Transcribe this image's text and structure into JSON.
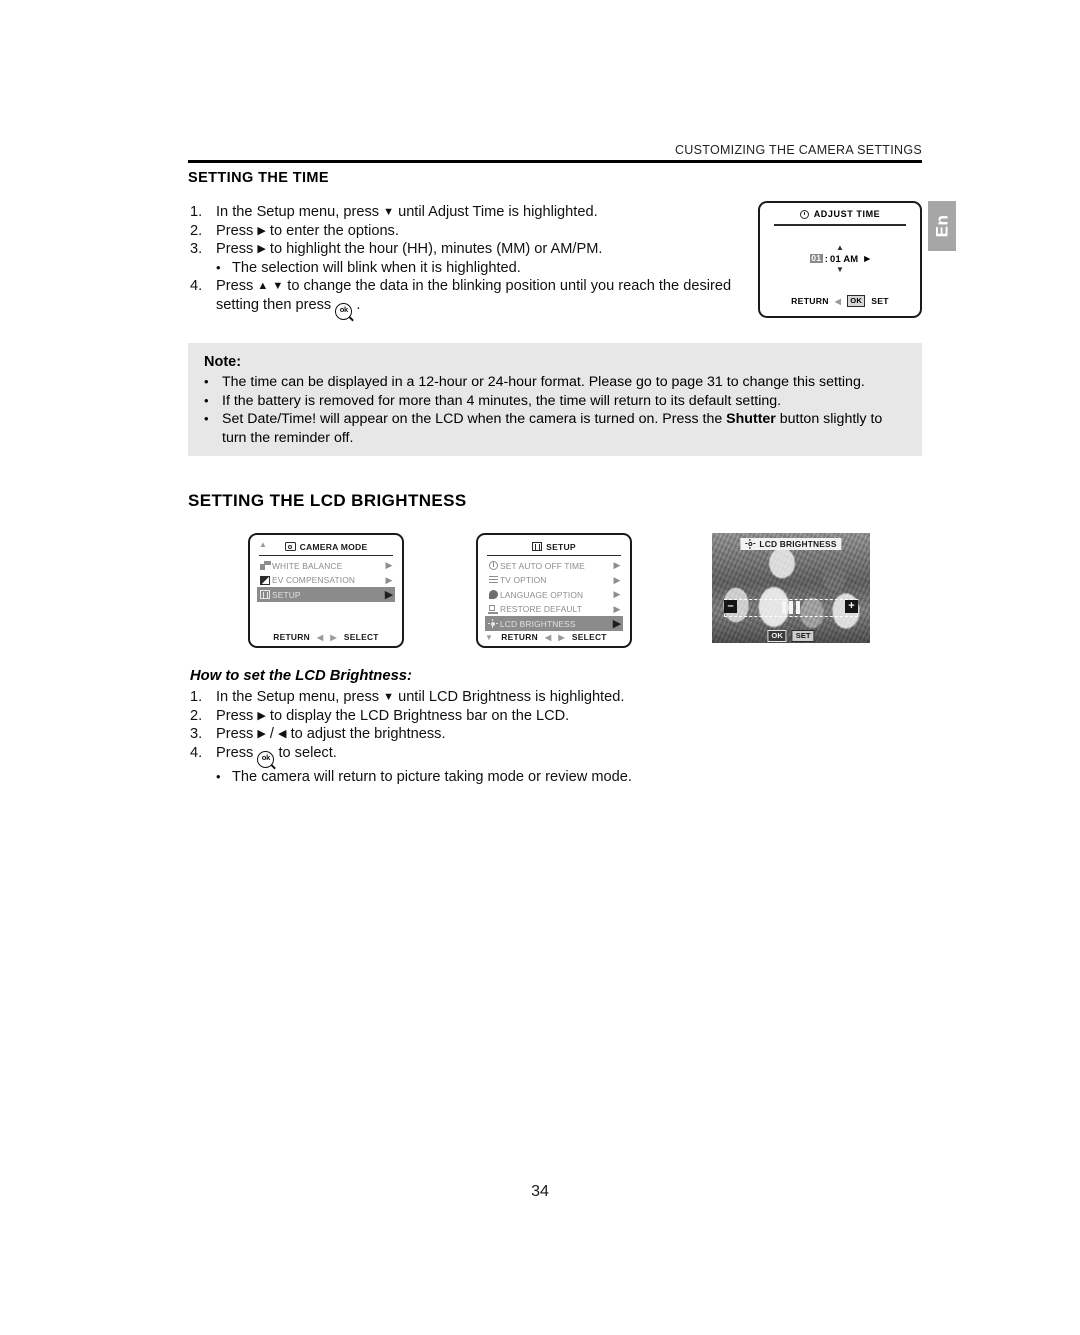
{
  "header": {
    "running_head": "CUSTOMIZING THE CAMERA SETTINGS",
    "language_tab": "En"
  },
  "sections": {
    "time": {
      "heading": "SETTING THE TIME",
      "steps": [
        {
          "num": "1.",
          "text_before": "In the Setup menu, press",
          "icon": "down-arrow-icon",
          "text_after": "until Adjust Time is highlighted."
        },
        {
          "num": "2.",
          "text_before": "Press",
          "icon": "right-arrow-icon",
          "text_after": "to enter the options."
        },
        {
          "num": "3.",
          "text_before": "Press",
          "icon": "right-arrow-icon",
          "text_after": "to highlight the hour (HH), minutes (MM) or AM/PM."
        }
      ],
      "sub_bullet": "The selection will blink when it is highlighted.",
      "step4": {
        "num": "4.",
        "text_before": "Press",
        "icons": "up-arrow-icon down-arrow-icon",
        "text_after": "to change the data in the blinking position until you reach the desired setting then press",
        "trailing": "."
      }
    },
    "lcd": {
      "heading": "SETTING THE LCD BRIGHTNESS",
      "how_title": "How to set the LCD Brightness:",
      "steps": [
        {
          "num": "1.",
          "text_before": "In the Setup menu, press",
          "icon": "down-arrow-icon",
          "text_after": "until LCD Brightness is highlighted."
        },
        {
          "num": "2.",
          "text_before": "Press",
          "icon": "right-arrow-icon",
          "text_after": "to display the LCD Brightness bar on the LCD."
        },
        {
          "num": "3.",
          "text_before": "Press",
          "icon": "right-arrow-icon",
          "mid": "/",
          "icon2": "left-arrow-icon",
          "text_after": "to adjust the brightness."
        },
        {
          "num": "4.",
          "text_before": "Press",
          "icon": "ok-button-icon",
          "text_after": "to select."
        }
      ],
      "sub_bullet": "The camera will return to picture taking mode or review mode."
    }
  },
  "note": {
    "title": "Note:",
    "items": [
      "The time can be displayed in a 12-hour or 24-hour format. Please go to page 31 to change this setting.",
      "If the battery is removed for more than 4 minutes, the time will return to its default setting.",
      "Set Date/Time! will appear on the LCD when the camera is turned on. Press the Shutter button slightly to turn the reminder off."
    ],
    "bold_word": "Shutter"
  },
  "screens": {
    "adjust_time": {
      "title": "ADJUST TIME",
      "hour": "01",
      "separator": ":",
      "minutes_ampm": "01 AM",
      "footer_return": "RETURN",
      "footer_ok": "OK",
      "footer_set": "SET"
    },
    "camera_mode": {
      "title": "CAMERA MODE",
      "items": [
        {
          "label": "WHITE BALANCE",
          "icon": "white-balance-icon",
          "selected": false
        },
        {
          "label": "EV COMPENSATION",
          "icon": "ev-compensation-icon",
          "selected": false
        },
        {
          "label": "SETUP",
          "icon": "setup-icon",
          "selected": true
        }
      ],
      "footer_return": "RETURN",
      "footer_select": "SELECT"
    },
    "setup": {
      "title": "SETUP",
      "items": [
        {
          "label": "SET AUTO OFF TIME",
          "icon": "power-icon",
          "selected": false
        },
        {
          "label": "TV OPTION",
          "icon": "tv-icon",
          "selected": false
        },
        {
          "label": "LANGUAGE OPTION",
          "icon": "language-icon",
          "selected": false
        },
        {
          "label": "RESTORE DEFAULT",
          "icon": "restore-icon",
          "selected": false
        },
        {
          "label": "LCD BRIGHTNESS",
          "icon": "brightness-sun-icon",
          "selected": true
        }
      ],
      "footer_return": "RETURN",
      "footer_select": "SELECT"
    },
    "brightness": {
      "title": "LCD BRIGHTNESS",
      "minus": "–",
      "plus": "+",
      "chip_ok": "OK",
      "chip_set": "SET"
    }
  },
  "footer": {
    "page_number": "34"
  }
}
